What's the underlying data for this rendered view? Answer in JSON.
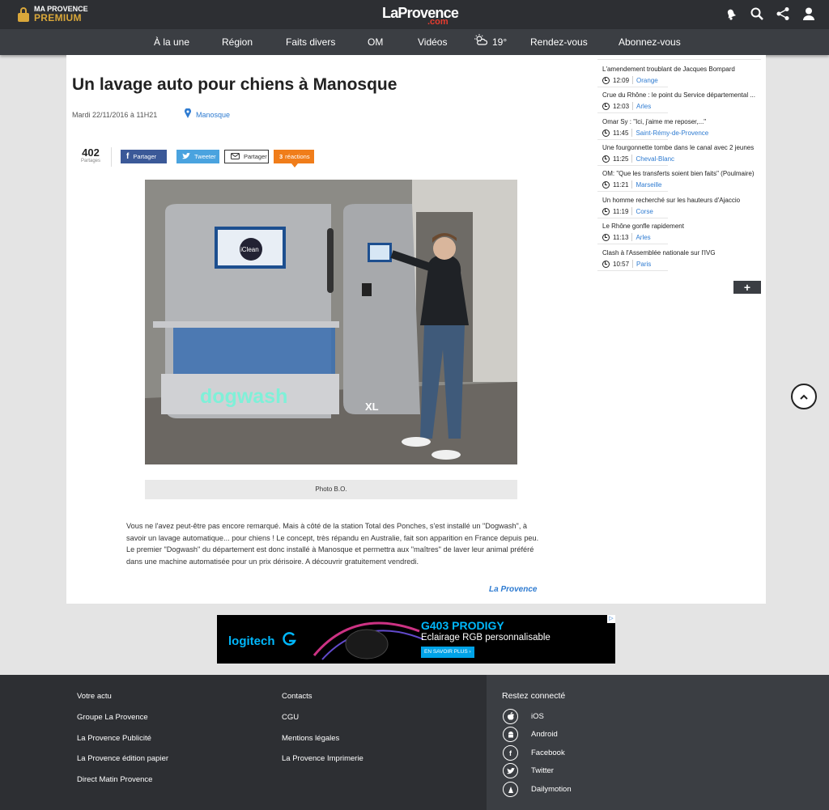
{
  "header": {
    "premium_line1": "MA PROVENCE",
    "premium_line2": "PREMIUM",
    "logo_main": "LaProvence",
    "logo_suffix": ".com",
    "icons": [
      "bell-icon",
      "search-icon",
      "share-icon",
      "user-icon"
    ]
  },
  "nav": {
    "items": [
      "À la une",
      "Région",
      "Faits divers",
      "OM",
      "Vidéos",
      "Rendez-vous",
      "Abonnez-vous"
    ],
    "weather_temp": "19°"
  },
  "article": {
    "title": "Un lavage auto pour chiens à Manosque",
    "date": "Mardi 22/11/2016 à 11H21",
    "location": "Manosque",
    "share_count": "402",
    "share_label": "Partages",
    "buttons": {
      "facebook": "Partager",
      "twitter": "Tweeter",
      "mail": "Partager",
      "reactions_count": "3",
      "reactions_label": "réactions"
    },
    "photo_labels": {
      "screen_brand": "iClean",
      "machine_brand": "dogwash",
      "machine_size": "XL"
    },
    "caption": "Photo B.O.",
    "body": "Vous ne l'avez peut-être pas encore remarqué. Mais à côté de la station Total  des Ponches, s'est installé un \"Dogwash\", à savoir un lavage automatique... pour chiens ! Le concept, très répandu en Australie, fait son apparition en France depuis peu. Le premier \"Dogwash\" du département est donc installé à Manosque et permettra aux \"maîtres\" de laver leur animal préféré dans une machine automatisée pour un prix dérisoire. A découvrir gratuitement vendredi.",
    "signature": "La Provence"
  },
  "sidebar": {
    "news": [
      {
        "title": "L'amendement troublant de Jacques Bompard",
        "time": "12:09",
        "place": "Orange"
      },
      {
        "title": "Crue du Rhône : le point du Service départemental ...",
        "time": "12:03",
        "place": "Arles"
      },
      {
        "title": "Omar Sy : \"Ici, j'aime me reposer,...\"",
        "time": "11:45",
        "place": "Saint-Rémy-de-Provence"
      },
      {
        "title": "Une fourgonnette tombe dans le canal avec 2 jeunes",
        "time": "11:25",
        "place": "Cheval-Blanc"
      },
      {
        "title": "OM: \"Que les transferts soient bien faits\" (Poulmaire)",
        "time": "11:21",
        "place": "Marseille"
      },
      {
        "title": "Un homme recherché sur les hauteurs d'Ajaccio",
        "time": "11:19",
        "place": "Corse"
      },
      {
        "title": "Le Rhône gonfle rapidement",
        "time": "11:13",
        "place": "Arles"
      },
      {
        "title": "Clash à l'Assemblée nationale sur l'IVG",
        "time": "10:57",
        "place": "Paris"
      }
    ],
    "more_label": "+"
  },
  "ad": {
    "brand": "logitech",
    "product": "G403 PRODIGY",
    "tagline": "Eclairage RGB personnalisable",
    "cta": "EN SAVOIR PLUS ›",
    "corner": "▷"
  },
  "footer": {
    "col1": [
      "Votre actu",
      "Groupe La Provence",
      "La Provence Publicité",
      "La Provence édition papier",
      "Direct Matin Provence"
    ],
    "col2": [
      "Contacts",
      "CGU",
      "Mentions légales",
      "La Provence Imprimerie"
    ],
    "social_title": "Restez connecté",
    "social": [
      {
        "label": "iOS",
        "icon": "apple-icon"
      },
      {
        "label": "Android",
        "icon": "android-icon"
      },
      {
        "label": "Facebook",
        "icon": "facebook-icon"
      },
      {
        "label": "Twitter",
        "icon": "twitter-icon"
      },
      {
        "label": "Dailymotion",
        "icon": "dailymotion-icon"
      }
    ]
  },
  "colors": {
    "header_bg": "#2d2f33",
    "nav_bg": "#3b3e43",
    "premium_gold": "#d9a73a",
    "logo_red": "#e63c2f",
    "link_blue": "#2e7bd1",
    "facebook_blue": "#3b5998",
    "twitter_blue": "#4aa3df",
    "reaction_orange": "#f07d1a"
  }
}
